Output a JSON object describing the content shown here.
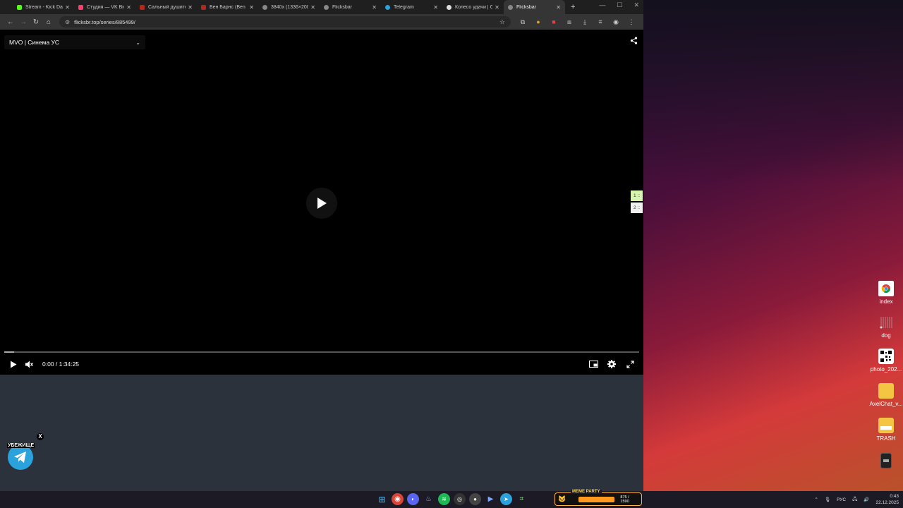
{
  "browser": {
    "tabs": [
      {
        "title": "Stream - Kick Dash",
        "favicon_color": "#53fc18"
      },
      {
        "title": "Студия — VK Видео",
        "favicon_color": "#ff3b6b"
      },
      {
        "title": "Сальный душител",
        "favicon_color": "#b2281c"
      },
      {
        "title": "Бен Барнс (Ben Ba",
        "favicon_color": "#b2281c"
      },
      {
        "title": "3840x (1336×2000)",
        "favicon_color": "#888888"
      },
      {
        "title": "Flicksbar",
        "favicon_color": "#888888"
      },
      {
        "title": "Telegram",
        "favicon_color": "#2aa3dd"
      },
      {
        "title": "Колесо удачи | On",
        "favicon_color": "#dddddd"
      },
      {
        "title": "Flicksbar",
        "favicon_color": "#888888",
        "active": true
      }
    ],
    "new_tab": "+",
    "url": "flicksbr.top/series/885499/"
  },
  "player": {
    "source_label": "MVO | Синема УС",
    "time_current": "0:00",
    "time_separator": "/",
    "time_total": "1:34:25",
    "progress_fraction": 0.0,
    "side_tabs": [
      "1 ::",
      "2 ::"
    ]
  },
  "widget": {
    "label": "УБЕЖИЩЕ",
    "close": "X"
  },
  "desktop_icons": [
    {
      "label": "index",
      "icon": "chrome-icon"
    },
    {
      "label": "dog",
      "icon": "file-icon"
    },
    {
      "label": "photo_202...",
      "icon": "qr-image-icon"
    },
    {
      "label": "AxelChat_v...",
      "icon": "folder-icon"
    },
    {
      "label": "TRASH",
      "icon": "folder-icon"
    },
    {
      "label": "",
      "icon": "archive-icon"
    }
  ],
  "taskbar": {
    "meme_widget": {
      "title": "MEME PARTY",
      "count": "875 / 1590"
    },
    "tray": {
      "lang": "РУС",
      "time": "0:43",
      "date": "22.12.2025"
    }
  }
}
